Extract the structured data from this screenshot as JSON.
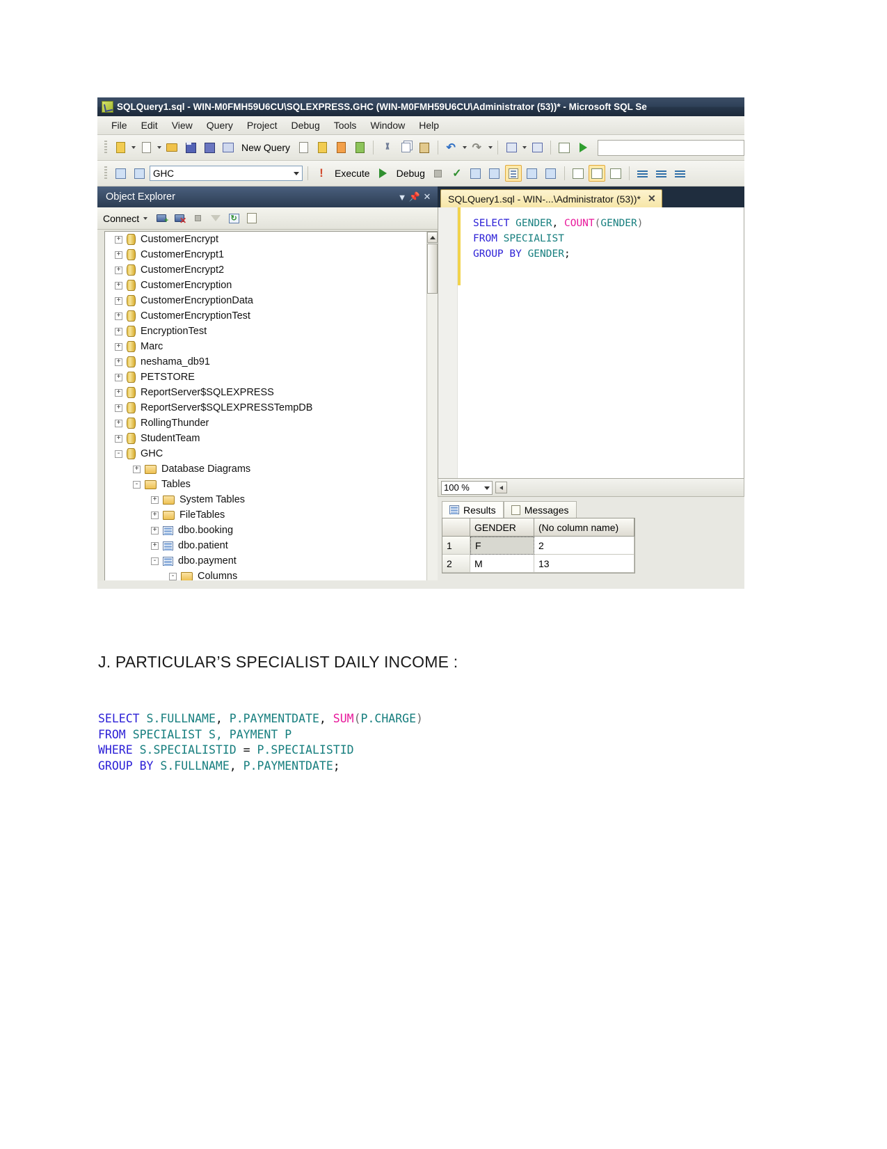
{
  "ssms": {
    "title": "SQLQuery1.sql - WIN-M0FMH59U6CU\\SQLEXPRESS.GHC (WIN-M0FMH59U6CU\\Administrator (53))* - Microsoft SQL Se",
    "menu": [
      "File",
      "Edit",
      "View",
      "Query",
      "Project",
      "Debug",
      "Tools",
      "Window",
      "Help"
    ],
    "toolbar1": {
      "new_query_label": "New Query"
    },
    "toolbar2": {
      "database_combo_value": "GHC",
      "execute_label": "Execute",
      "debug_label": "Debug"
    },
    "object_explorer": {
      "title": "Object Explorer",
      "connect_label": "Connect",
      "tree": [
        {
          "label": "CustomerEncrypt",
          "indent": 0,
          "expander": "+",
          "icon": "database-icon"
        },
        {
          "label": "CustomerEncrypt1",
          "indent": 0,
          "expander": "+",
          "icon": "database-icon"
        },
        {
          "label": "CustomerEncrypt2",
          "indent": 0,
          "expander": "+",
          "icon": "database-icon"
        },
        {
          "label": "CustomerEncryption",
          "indent": 0,
          "expander": "+",
          "icon": "database-icon"
        },
        {
          "label": "CustomerEncryptionData",
          "indent": 0,
          "expander": "+",
          "icon": "database-icon"
        },
        {
          "label": "CustomerEncryptionTest",
          "indent": 0,
          "expander": "+",
          "icon": "database-icon"
        },
        {
          "label": "EncryptionTest",
          "indent": 0,
          "expander": "+",
          "icon": "database-icon"
        },
        {
          "label": "Marc",
          "indent": 0,
          "expander": "+",
          "icon": "database-icon"
        },
        {
          "label": "neshama_db91",
          "indent": 0,
          "expander": "+",
          "icon": "database-icon"
        },
        {
          "label": "PETSTORE",
          "indent": 0,
          "expander": "+",
          "icon": "database-icon"
        },
        {
          "label": "ReportServer$SQLEXPRESS",
          "indent": 0,
          "expander": "+",
          "icon": "database-icon"
        },
        {
          "label": "ReportServer$SQLEXPRESSTempDB",
          "indent": 0,
          "expander": "+",
          "icon": "database-icon"
        },
        {
          "label": "RollingThunder",
          "indent": 0,
          "expander": "+",
          "icon": "database-icon"
        },
        {
          "label": "StudentTeam",
          "indent": 0,
          "expander": "+",
          "icon": "database-icon"
        },
        {
          "label": "GHC",
          "indent": 0,
          "expander": "-",
          "icon": "database-icon"
        },
        {
          "label": "Database Diagrams",
          "indent": 1,
          "expander": "+",
          "icon": "folder-icon"
        },
        {
          "label": "Tables",
          "indent": 1,
          "expander": "-",
          "icon": "folder-icon"
        },
        {
          "label": "System Tables",
          "indent": 2,
          "expander": "+",
          "icon": "folder-icon"
        },
        {
          "label": "FileTables",
          "indent": 2,
          "expander": "+",
          "icon": "folder-icon"
        },
        {
          "label": "dbo.booking",
          "indent": 2,
          "expander": "+",
          "icon": "table-icon"
        },
        {
          "label": "dbo.patient",
          "indent": 2,
          "expander": "+",
          "icon": "table-icon"
        },
        {
          "label": "dbo.payment",
          "indent": 2,
          "expander": "-",
          "icon": "table-icon"
        },
        {
          "label": "Columns",
          "indent": 3,
          "expander": "-",
          "icon": "folder-icon"
        }
      ]
    },
    "query_tab": {
      "label": "SQLQuery1.sql - WIN-...\\Administrator (53))*",
      "close": "✕"
    },
    "editor_code": [
      {
        "parts": [
          {
            "t": "SELECT",
            "c": "k"
          },
          {
            "t": " ",
            "c": "n"
          },
          {
            "t": "GENDER",
            "c": "t"
          },
          {
            "t": ", ",
            "c": "n"
          },
          {
            "t": "COUNT",
            "c": "f"
          },
          {
            "t": "(",
            "c": "p"
          },
          {
            "t": "GENDER",
            "c": "t"
          },
          {
            "t": ")",
            "c": "p"
          }
        ]
      },
      {
        "parts": [
          {
            "t": "FROM",
            "c": "k"
          },
          {
            "t": " ",
            "c": "n"
          },
          {
            "t": "SPECIALIST",
            "c": "t"
          }
        ]
      },
      {
        "parts": [
          {
            "t": "GROUP BY",
            "c": "k"
          },
          {
            "t": " ",
            "c": "n"
          },
          {
            "t": "GENDER",
            "c": "t"
          },
          {
            "t": ";",
            "c": "n"
          }
        ]
      }
    ],
    "zoom_level": "100 %",
    "results": {
      "tabs": [
        "Results",
        "Messages"
      ],
      "columns": [
        "",
        "GENDER",
        "(No column name)"
      ],
      "rows": [
        [
          "1",
          "F",
          "2"
        ],
        [
          "2",
          "M",
          "13"
        ]
      ]
    }
  },
  "document": {
    "heading": "J. PARTICULAR’S SPECIALIST DAILY INCOME :",
    "code_lines": [
      {
        "parts": [
          {
            "t": "SELECT",
            "c": "k"
          },
          {
            "t": " ",
            "c": "n"
          },
          {
            "t": "S.FULLNAME",
            "c": "t"
          },
          {
            "t": ", ",
            "c": "n"
          },
          {
            "t": "P.PAYMENTDATE",
            "c": "t"
          },
          {
            "t": ", ",
            "c": "n"
          },
          {
            "t": "SUM",
            "c": "f"
          },
          {
            "t": "(",
            "c": "p"
          },
          {
            "t": "P.CHARGE",
            "c": "t"
          },
          {
            "t": ")",
            "c": "p"
          }
        ]
      },
      {
        "parts": [
          {
            "t": "FROM",
            "c": "k"
          },
          {
            "t": " ",
            "c": "n"
          },
          {
            "t": "SPECIALIST S, PAYMENT P",
            "c": "t"
          }
        ]
      },
      {
        "parts": [
          {
            "t": "WHERE",
            "c": "k"
          },
          {
            "t": " ",
            "c": "n"
          },
          {
            "t": "S.SPECIALISTID",
            "c": "t"
          },
          {
            "t": " = ",
            "c": "n"
          },
          {
            "t": "P.SPECIALISTID",
            "c": "t"
          }
        ]
      },
      {
        "parts": [
          {
            "t": "GROUP BY",
            "c": "k"
          },
          {
            "t": " ",
            "c": "n"
          },
          {
            "t": "S.FULLNAME",
            "c": "t"
          },
          {
            "t": ", ",
            "c": "n"
          },
          {
            "t": "P.PAYMENTDATE",
            "c": "t"
          },
          {
            "t": ";",
            "c": "n"
          }
        ]
      }
    ]
  },
  "colors": {
    "keyword": "#2b1fd6",
    "identifier": "#167e7e",
    "function": "#e8189b",
    "tab_accent": "#f6e6a8",
    "titlebar": "#2f4158"
  }
}
